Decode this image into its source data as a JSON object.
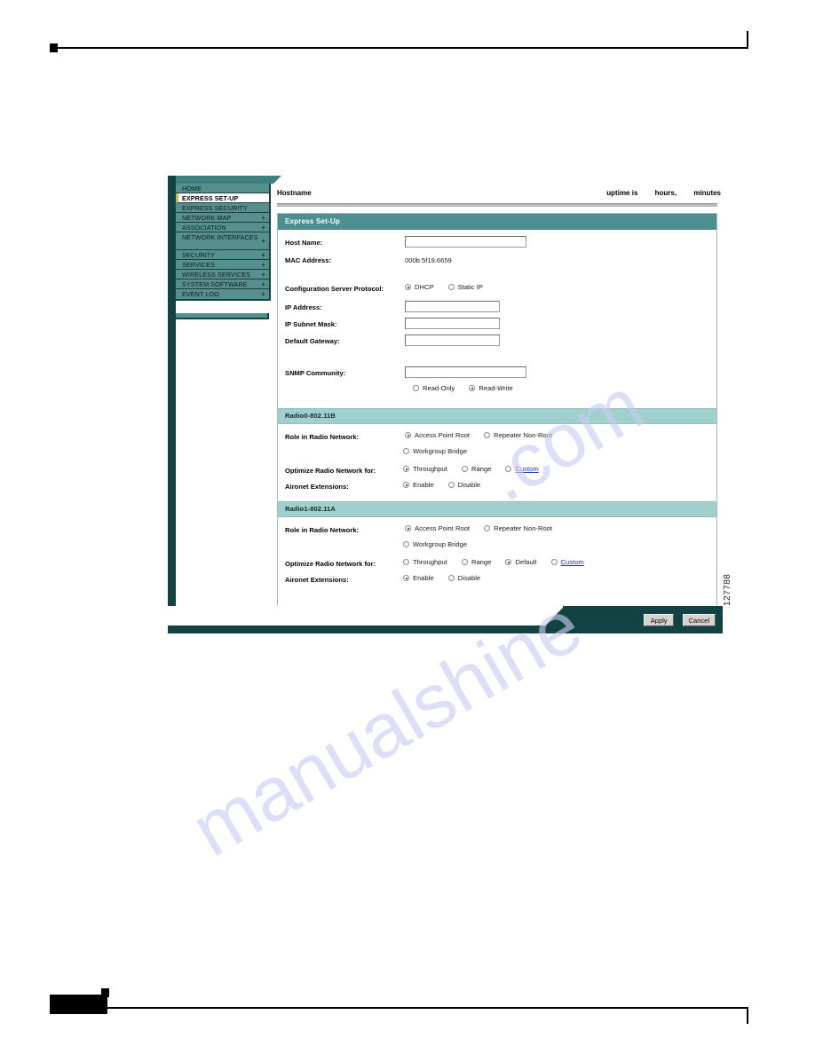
{
  "figure": {
    "number": "127788"
  },
  "watermark": {
    "line1": "manualshine",
    "line2": ".com"
  },
  "window": {
    "titlebar": {
      "hostname": "Hostname",
      "uptime_label": "uptime is",
      "uptime_hours": "hours,",
      "uptime_minutes": "minutes"
    },
    "sidebar": {
      "items": [
        {
          "label": "HOME",
          "expandable": false,
          "selected": false
        },
        {
          "label": "EXPRESS SET-UP",
          "expandable": false,
          "selected": true
        },
        {
          "label": "EXPRESS SECURITY",
          "expandable": false,
          "selected": false
        },
        {
          "label": "NETWORK MAP",
          "expandable": true,
          "selected": false
        },
        {
          "label": "ASSOCIATION",
          "expandable": true,
          "selected": false
        },
        {
          "label": "NETWORK INTERFACES",
          "expandable": true,
          "selected": false
        },
        {
          "label": "SECURITY",
          "expandable": true,
          "selected": false
        },
        {
          "label": "SERVICES",
          "expandable": true,
          "selected": false
        },
        {
          "label": "WIRELESS SERVICES",
          "expandable": true,
          "selected": false
        },
        {
          "label": "SYSTEM SOFTWARE",
          "expandable": true,
          "selected": false
        },
        {
          "label": "EVENT LOG",
          "expandable": true,
          "selected": false
        }
      ],
      "expand_icon": "+"
    },
    "form": {
      "header": "Express Set-Up",
      "host_name_label": "Host Name:",
      "host_name_value": "",
      "mac_address_label": "MAC Address:",
      "mac_address_value": "000b.5f19.6659",
      "config_protocol_label": "Configuration Server Protocol:",
      "config_protocol_options": [
        {
          "label": "DHCP",
          "selected": true
        },
        {
          "label": "Static IP",
          "selected": false
        }
      ],
      "ip_address_label": "IP Address:",
      "ip_address_value": "",
      "ip_subnet_label": "IP Subnet Mask:",
      "ip_subnet_value": "",
      "default_gateway_label": "Default Gateway:",
      "default_gateway_value": "",
      "snmp_label": "SNMP Community:",
      "snmp_value": "",
      "snmp_options": [
        {
          "label": "Read-Only",
          "selected": false
        },
        {
          "label": "Read-Write",
          "selected": true
        }
      ]
    },
    "radio0": {
      "header": "Radio0-802.11B",
      "role_label": "Role in Radio Network:",
      "role_options": [
        {
          "label": "Access Point Root",
          "selected": true
        },
        {
          "label": "Repeater Non-Root",
          "selected": false
        },
        {
          "label": "Workgroup Bridge",
          "selected": false
        }
      ],
      "optimize_label": "Optimize Radio Network for:",
      "optimize_options": [
        {
          "label": "Throughput",
          "selected": true,
          "link": false
        },
        {
          "label": "Range",
          "selected": false,
          "link": false
        },
        {
          "label": "Custom",
          "selected": false,
          "link": true
        }
      ],
      "aironet_label": "Aironet Extensions:",
      "aironet_options": [
        {
          "label": "Enable",
          "selected": true
        },
        {
          "label": "Disable",
          "selected": false
        }
      ]
    },
    "radio1": {
      "header": "Radio1-802.11A",
      "role_label": "Role in Radio Network:",
      "role_options": [
        {
          "label": "Access Point Root",
          "selected": true
        },
        {
          "label": "Repeater Non-Root",
          "selected": false
        },
        {
          "label": "Workgroup Bridge",
          "selected": false
        }
      ],
      "optimize_label": "Optimize Radio Network for:",
      "optimize_options": [
        {
          "label": "Throughput",
          "selected": false,
          "link": false
        },
        {
          "label": "Range",
          "selected": false,
          "link": false
        },
        {
          "label": "Default",
          "selected": true,
          "link": false
        },
        {
          "label": "Custom",
          "selected": false,
          "link": true
        }
      ],
      "aironet_label": "Aironet Extensions:",
      "aironet_options": [
        {
          "label": "Enable",
          "selected": true
        },
        {
          "label": "Disable",
          "selected": false
        }
      ]
    },
    "buttons": {
      "apply": "Apply",
      "cancel": "Cancel"
    }
  },
  "colors": {
    "chrome_dark": "#134242",
    "header_teal": "#4d8f91",
    "section_teal": "#9fd0cd",
    "sidebar_teal": "#55908f",
    "link_blue": "#2338a8",
    "watermark": "#c9cdf2"
  }
}
